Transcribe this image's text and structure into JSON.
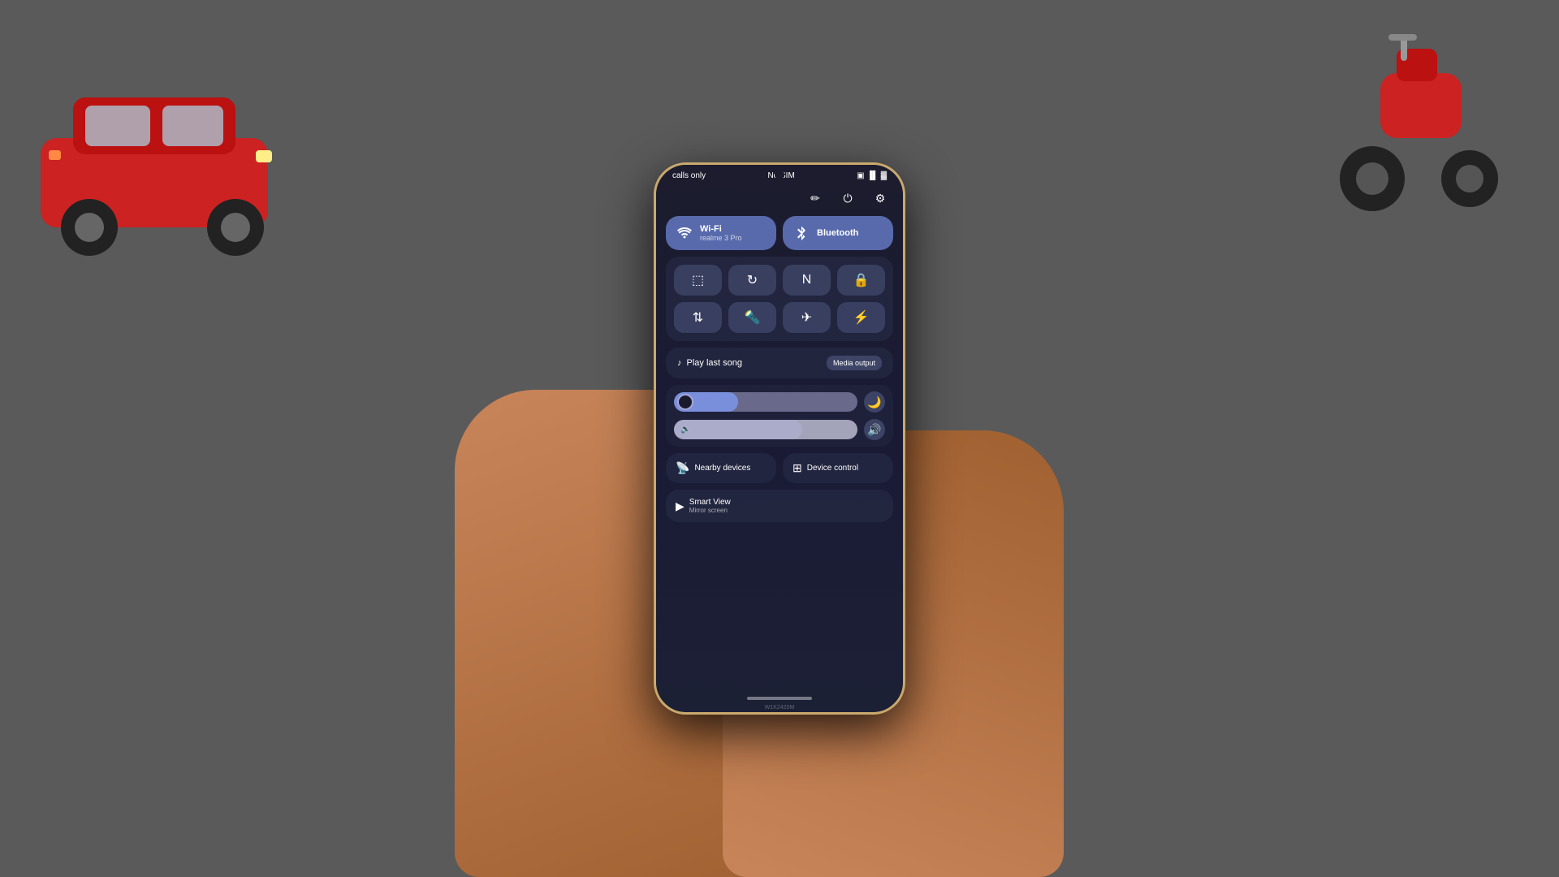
{
  "scene": {
    "background_color": "#5a5555"
  },
  "status_bar": {
    "left": "calls only",
    "center": "No SIM",
    "battery": "🔋",
    "signal": "📶"
  },
  "top_icons": {
    "edit": "✏️",
    "power": "⏻",
    "settings": "⚙"
  },
  "toggles": {
    "wifi": {
      "label": "Wi-Fi",
      "sublabel": "realme 3 Pro",
      "active": true,
      "icon": "wifi"
    },
    "bluetooth": {
      "label": "Bluetooth",
      "sublabel": "",
      "active": true,
      "icon": "bt"
    }
  },
  "quick_tiles": [
    {
      "id": "screenshot",
      "icon": "⬜",
      "active": false
    },
    {
      "id": "rotate",
      "icon": "🔄",
      "active": false
    },
    {
      "id": "nfc",
      "icon": "N",
      "active": false
    },
    {
      "id": "lock",
      "icon": "🔒",
      "active": false
    },
    {
      "id": "transfer",
      "icon": "⇅",
      "active": false
    },
    {
      "id": "flashlight",
      "icon": "🔦",
      "active": false
    },
    {
      "id": "airplane",
      "icon": "✈",
      "active": false
    },
    {
      "id": "battery",
      "icon": "🔋",
      "active": false
    }
  ],
  "media_player": {
    "icon": "♪",
    "label": "Play last song",
    "media_output_label": "Media output"
  },
  "brightness_slider": {
    "fill_percent": 35,
    "night_icon": "🌙"
  },
  "volume_slider": {
    "fill_percent": 70,
    "icon": "🔊",
    "sound_icon": "🔉"
  },
  "bottom_row": [
    {
      "id": "nearby-devices",
      "icon": "📡",
      "label": "Nearby devices"
    },
    {
      "id": "device-control",
      "icon": "⊞",
      "label": "Device control"
    }
  ],
  "smart_view": {
    "icon": "▶",
    "label": "Smart View",
    "sublabel": "Mirror screen"
  },
  "model_number": "W1K2420M"
}
